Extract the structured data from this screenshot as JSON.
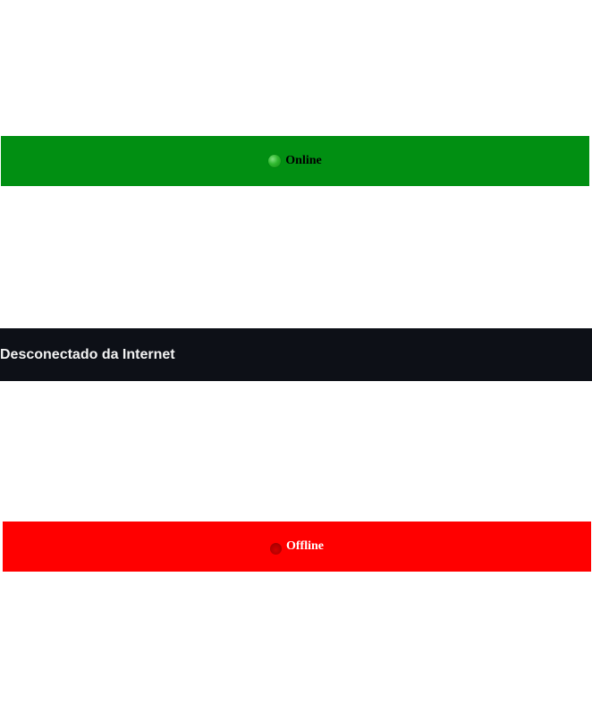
{
  "online_status": {
    "label": "Online",
    "icon": "green-dot-icon",
    "background_color": "#018f12",
    "text_color": "#000000"
  },
  "disconnected_banner": {
    "text": "Desconectado da Internet",
    "background_color": "#0d1017",
    "text_color": "#f2f2f2"
  },
  "offline_status": {
    "label": "Offline",
    "icon": "red-dot-icon",
    "background_color": "#ff0000",
    "text_color": "#ffffff"
  }
}
